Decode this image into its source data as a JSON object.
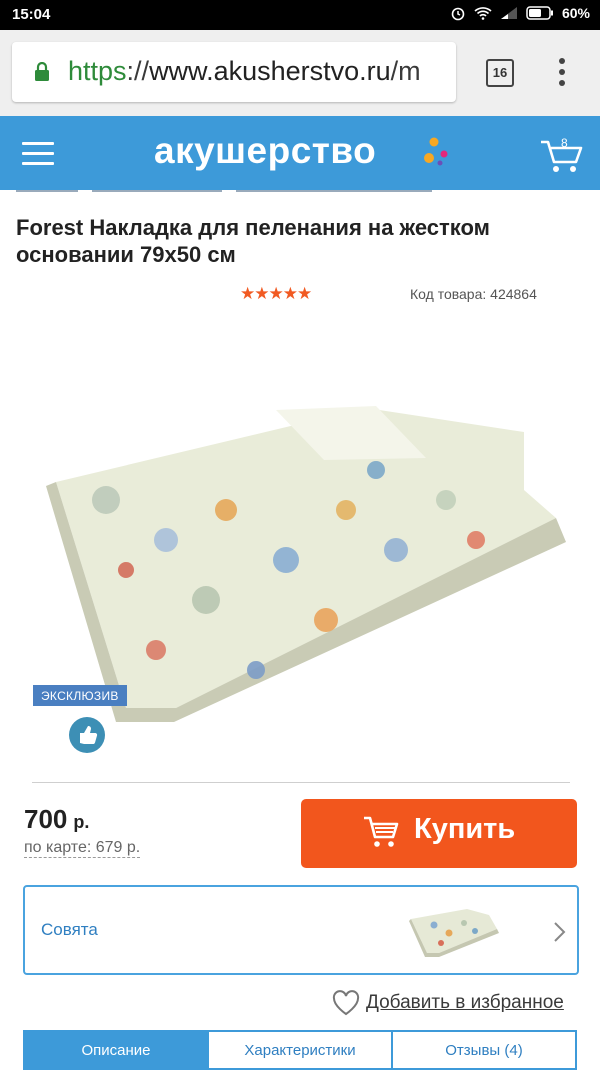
{
  "status_bar": {
    "time": "15:04",
    "battery": "60%"
  },
  "browser": {
    "url_protocol": "https",
    "url_sep": "://",
    "url_host": "www.akusherstvo.ru",
    "url_tail": "/m",
    "tab_count": "16"
  },
  "header": {
    "logo": "акушерство",
    "cart_count": "8",
    "accent_colors": [
      "#f7a823",
      "#e2287c",
      "#6a4fb8"
    ]
  },
  "product": {
    "title": "Forest Накладка для пеленания на жестком основании 79х50 см",
    "rating_stars": "★★★★★",
    "rating": 5,
    "sku": "Код товара: 424864",
    "badge": "ЭКСКЛЮЗИВ",
    "price_value": "700",
    "price_currency": "р.",
    "card_price": "по карте: 679 р.",
    "buy_label": "Купить",
    "brand": "Совята",
    "favorite_label": "Добавить в избранное"
  },
  "tabs": [
    {
      "label": "Описание",
      "active": true
    },
    {
      "label": "Характеристики",
      "active": false
    },
    {
      "label": "Отзывы (4)",
      "active": false
    }
  ],
  "colors": {
    "header_blue": "#3d9ad9",
    "buy_orange": "#f2561d",
    "star_orange": "#f15a22"
  }
}
